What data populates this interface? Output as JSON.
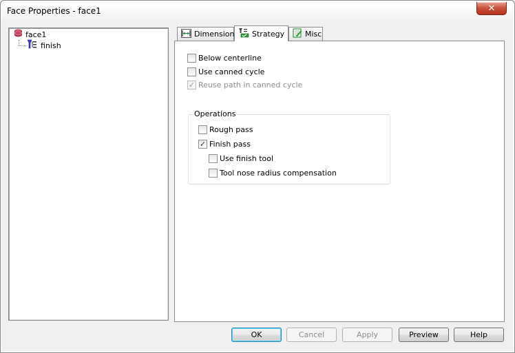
{
  "window": {
    "title": "Face Properties - face1",
    "close_glyph": "✕"
  },
  "tree": {
    "root": {
      "label": "face1",
      "icon": "database-icon"
    },
    "child": {
      "label": "finish",
      "icon": "toolpath-icon"
    }
  },
  "tabs": [
    {
      "label": "Dimensions",
      "icon": "dimensions-icon",
      "active": false
    },
    {
      "label": "Strategy",
      "icon": "strategy-icon",
      "active": true
    },
    {
      "label": "Misc",
      "icon": "misc-icon",
      "active": false
    }
  ],
  "strategy": {
    "below_centerline": {
      "label": "Below centerline",
      "checked": false,
      "enabled": true
    },
    "use_canned_cycle": {
      "label": "Use canned cycle",
      "checked": false,
      "enabled": true
    },
    "reuse_path": {
      "label": "Reuse path in canned cycle",
      "checked": true,
      "enabled": false
    },
    "operations": {
      "legend": "Operations",
      "rough_pass": {
        "label": "Rough pass",
        "checked": false
      },
      "finish_pass": {
        "label": "Finish pass",
        "checked": true
      },
      "use_finish_tool": {
        "label": "Use finish tool",
        "checked": false
      },
      "tool_nose": {
        "label": "Tool nose radius compensation",
        "checked": false
      }
    }
  },
  "buttons": {
    "ok": "OK",
    "cancel": "Cancel",
    "apply": "Apply",
    "preview": "Preview",
    "help": "Help"
  },
  "colors": {
    "accent_blue": "#3c7fb1",
    "close_red": "#c7503a",
    "check_green": "#2e9b3a"
  }
}
